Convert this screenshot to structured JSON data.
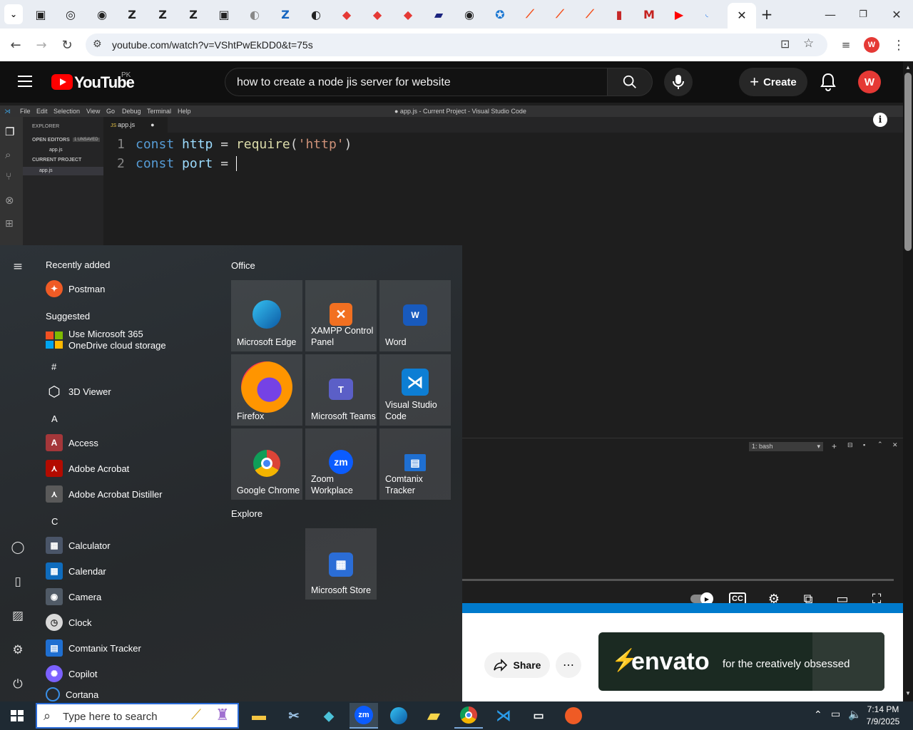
{
  "browser": {
    "url": "youtube.com/watch?v=VShtPwEkDD0&t=75s",
    "profile_initial": "W"
  },
  "youtube": {
    "country": "PK",
    "logo_text": "YouTube",
    "search_query": "how to create a node jis server for website",
    "create_label": "Create",
    "avatar_initial": "W",
    "share_label": "Share"
  },
  "vscode": {
    "menu": [
      "File",
      "Edit",
      "Selection",
      "View",
      "Go",
      "Debug",
      "Terminal",
      "Help"
    ],
    "window_title": "● app.js - Current Project - Visual Studio Code",
    "explorer_title": "EXPLORER",
    "open_editors": "OPEN EDITORS",
    "unsaved": "1 UNSAVED",
    "open_file": "app.js",
    "current_project": "CURRENT PROJECT",
    "project_file": "app.js",
    "tab_label": "app.js",
    "code": [
      {
        "num": "1",
        "kw": "const",
        "var": "http",
        "op": " = ",
        "fn": "require",
        "p1": "(",
        "str": "'http'",
        "p2": ")"
      },
      {
        "num": "2",
        "kw": "const",
        "var": "port",
        "op": " = ",
        "fn": "",
        "p1": "",
        "str": "",
        "p2": ""
      }
    ],
    "terminal_select": "1: bash"
  },
  "ad": {
    "logo": "envato",
    "tagline": "for the creatively obsessed"
  },
  "startmenu": {
    "recently_added": "Recently added",
    "suggested": "Suggested",
    "office": "Office",
    "explore": "Explore",
    "apps": [
      {
        "label": "Postman",
        "color": "#ef5b25",
        "glyph": "✦"
      },
      {
        "label": "Use Microsoft 365",
        "label2": "OneDrive cloud storage",
        "color": "#f25022",
        "glyph": ""
      },
      {
        "label": "3D Viewer",
        "color": "transparent",
        "glyph": "⬡"
      },
      {
        "label": "Access",
        "color": "#a4373a",
        "glyph": "A"
      },
      {
        "label": "Adobe Acrobat",
        "color": "#b30b00",
        "glyph": "⋏"
      },
      {
        "label": "Adobe Acrobat Distiller",
        "color": "#5a5a5a",
        "glyph": "⋏"
      },
      {
        "label": "Calculator",
        "color": "#4a5568",
        "glyph": "▦"
      },
      {
        "label": "Calendar",
        "color": "#0f6cbd",
        "glyph": "▦"
      },
      {
        "label": "Camera",
        "color": "#505a66",
        "glyph": "◉"
      },
      {
        "label": "Clock",
        "color": "#d9d9d9",
        "glyph": "◷"
      },
      {
        "label": "Comtanix Tracker",
        "color": "#1f6fd1",
        "glyph": "▤"
      },
      {
        "label": "Copilot",
        "color": "#7b61ff",
        "glyph": "✺"
      },
      {
        "label": "Cortana",
        "color": "transparent",
        "glyph": "○"
      }
    ],
    "letters": [
      "#",
      "A",
      "C"
    ],
    "tiles": [
      {
        "label": "Microsoft Edge",
        "color": "#0a84d6",
        "glyph": "e"
      },
      {
        "label": "XAMPP Control Panel",
        "color": "#f27021",
        "glyph": "X"
      },
      {
        "label": "Word",
        "color": "#185abd",
        "glyph": "W"
      },
      {
        "label": "Firefox",
        "color": "#ff7139",
        "glyph": ""
      },
      {
        "label": "Microsoft Teams",
        "color": "#5b5fc7",
        "glyph": "T"
      },
      {
        "label": "Visual Studio Code",
        "color": "#0d7ed4",
        "glyph": "⋊"
      },
      {
        "label": "Google Chrome",
        "color": "#db4437",
        "glyph": ""
      },
      {
        "label": "Zoom Workplace",
        "color": "#0b5cff",
        "glyph": "zm"
      },
      {
        "label": "Comtanix Tracker",
        "color": "#1f6fd1",
        "glyph": "▤"
      },
      {
        "label": "Microsoft Store",
        "color": "#2b6dd6",
        "glyph": "▦"
      }
    ]
  },
  "taskbar": {
    "search_placeholder": "Type here to search",
    "time": "7:14 PM",
    "date": "7/9/2025"
  }
}
